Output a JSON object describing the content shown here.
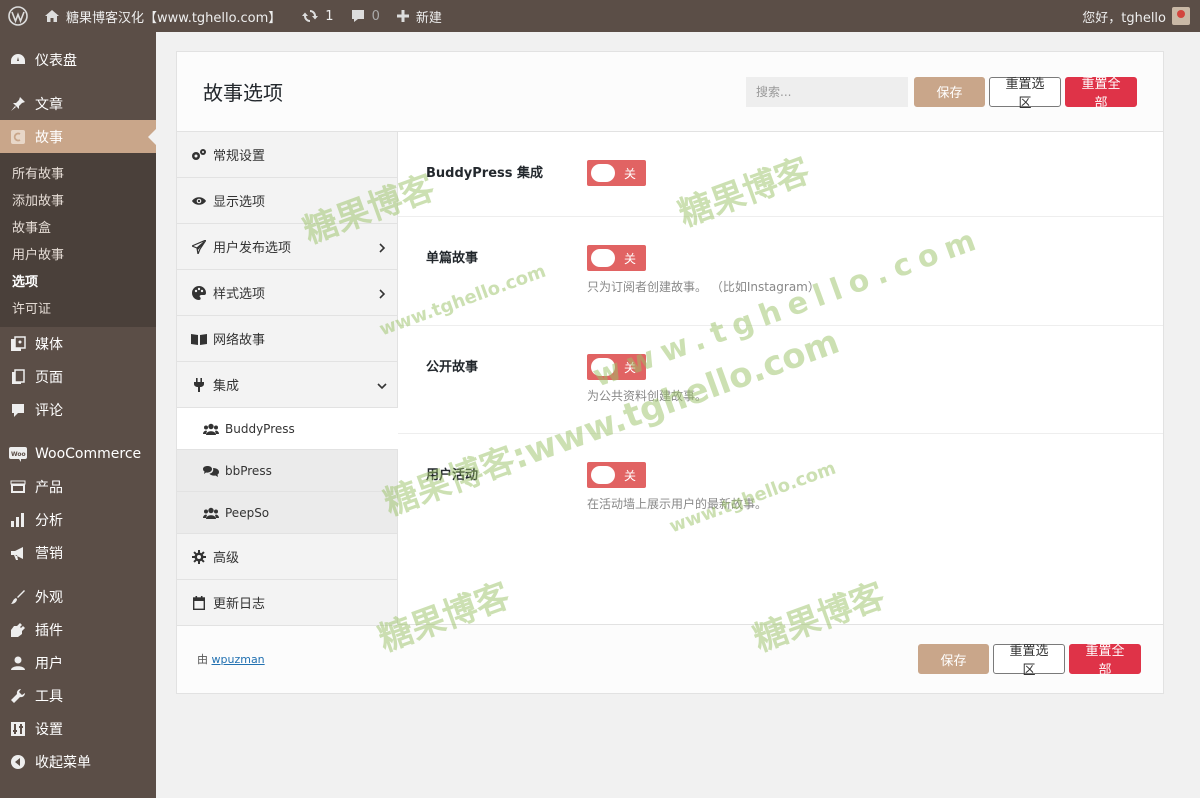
{
  "adminbar": {
    "site_name": "糖果博客汉化【www.tghello.com】",
    "updates_count": "1",
    "comments_count": "0",
    "new_label": "新建",
    "greeting": "您好，tghello"
  },
  "sidebar": {
    "items": [
      {
        "label": "仪表盘",
        "icon": "dashboard-icon"
      },
      {
        "label": "文章",
        "icon": "pin-icon"
      },
      {
        "label": "故事",
        "icon": "story-icon",
        "active": true
      },
      {
        "label": "媒体",
        "icon": "media-icon"
      },
      {
        "label": "页面",
        "icon": "page-icon"
      },
      {
        "label": "评论",
        "icon": "comment-icon"
      },
      {
        "label": "WooCommerce",
        "icon": "woo-icon"
      },
      {
        "label": "产品",
        "icon": "product-icon"
      },
      {
        "label": "分析",
        "icon": "analytics-icon"
      },
      {
        "label": "营销",
        "icon": "megaphone-icon"
      },
      {
        "label": "外观",
        "icon": "brush-icon"
      },
      {
        "label": "插件",
        "icon": "plugin-icon"
      },
      {
        "label": "用户",
        "icon": "user-icon"
      },
      {
        "label": "工具",
        "icon": "wrench-icon"
      },
      {
        "label": "设置",
        "icon": "settings-icon"
      },
      {
        "label": "收起菜单",
        "icon": "collapse-icon"
      }
    ],
    "submenu": [
      "所有故事",
      "添加故事",
      "故事盒",
      "用户故事",
      "选项",
      "许可证"
    ]
  },
  "panel": {
    "title": "故事选项",
    "search_placeholder": "搜索...",
    "save_label": "保存",
    "reset_section_label": "重置选区",
    "reset_all_label": "重置全部"
  },
  "nav": {
    "items": [
      {
        "label": "常规设置",
        "icon": "gears-icon"
      },
      {
        "label": "显示选项",
        "icon": "eye-icon"
      },
      {
        "label": "用户发布选项",
        "icon": "paper-plane-icon",
        "chevron": "right"
      },
      {
        "label": "样式选项",
        "icon": "palette-icon",
        "chevron": "right"
      },
      {
        "label": "网络故事",
        "icon": "book-icon"
      },
      {
        "label": "集成",
        "icon": "plug-icon",
        "chevron": "down"
      }
    ],
    "subitems": [
      {
        "label": "BuddyPress",
        "icon": "users-icon",
        "active": true
      },
      {
        "label": "bbPress",
        "icon": "comments-icon"
      },
      {
        "label": "PeepSo",
        "icon": "users-icon"
      }
    ],
    "tail_items": [
      {
        "label": "高级",
        "icon": "gear-icon"
      },
      {
        "label": "更新日志",
        "icon": "calendar-icon"
      }
    ]
  },
  "fields": [
    {
      "label": "BuddyPress 集成",
      "state": "关",
      "desc": ""
    },
    {
      "label": "单篇故事",
      "state": "关",
      "desc": "只为订阅者创建故事。 （比如Instagram）"
    },
    {
      "label": "公开故事",
      "state": "关",
      "desc": "为公共资料创建故事。"
    },
    {
      "label": "用户活动",
      "state": "关",
      "desc": "在活动墙上展示用户的最新故事。"
    }
  ],
  "footer": {
    "credit_prefix": "由",
    "credit_link": "wpuzman"
  },
  "watermarks": {
    "cn": "糖果博客",
    "url": "www.tghello.com",
    "combo": "糖果博客:www.tghello.com"
  },
  "colors": {
    "sidebar_bg": "#5b4e47",
    "accent": "#c9a68a",
    "danger": "#df3348",
    "toggle_off": "#e16363"
  }
}
